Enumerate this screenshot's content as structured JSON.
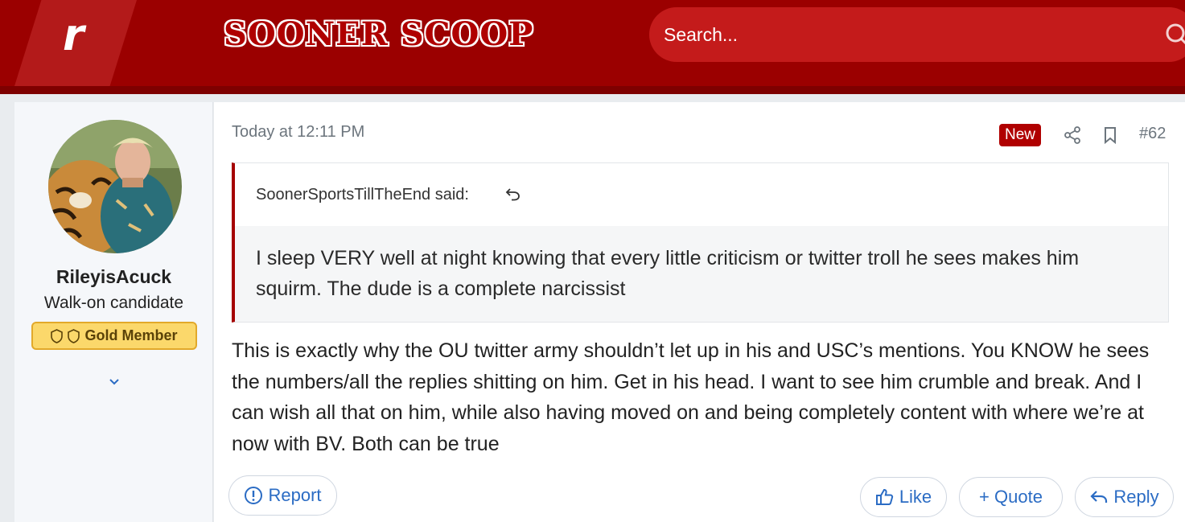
{
  "header": {
    "logo_letter": "r",
    "brand": "SOONER SCOOP",
    "search_placeholder": "Search...",
    "colors": {
      "header": "#9b0000",
      "search": "#c41b1b",
      "accent": "#b00000"
    }
  },
  "user": {
    "name": "RileyisAcuck",
    "title": "Walk-on candidate",
    "badge": "Gold Member",
    "avatar": "tiger-and-man-photo"
  },
  "post": {
    "timestamp": "Today at 12:11 PM",
    "new_label": "New",
    "number": "#62",
    "quote_author": "SoonerSportsTillTheEnd said:",
    "quote_text": "I sleep VERY well at night knowing that every little criticism or twitter troll he sees makes him squirm. The dude is a complete narcissist",
    "body": "This is exactly why the OU twitter army shouldn’t let up in his and USC’s mentions. You KNOW he sees the numbers/all the replies shitting on him. Get in his head. I want to see him crumble and break. And I can wish all that on him, while also having moved on and being completely content with where we’re at now with BV. Both can be true"
  },
  "actions": {
    "report": "Report",
    "like": "Like",
    "quote": "+ Quote",
    "reply": "Reply"
  }
}
